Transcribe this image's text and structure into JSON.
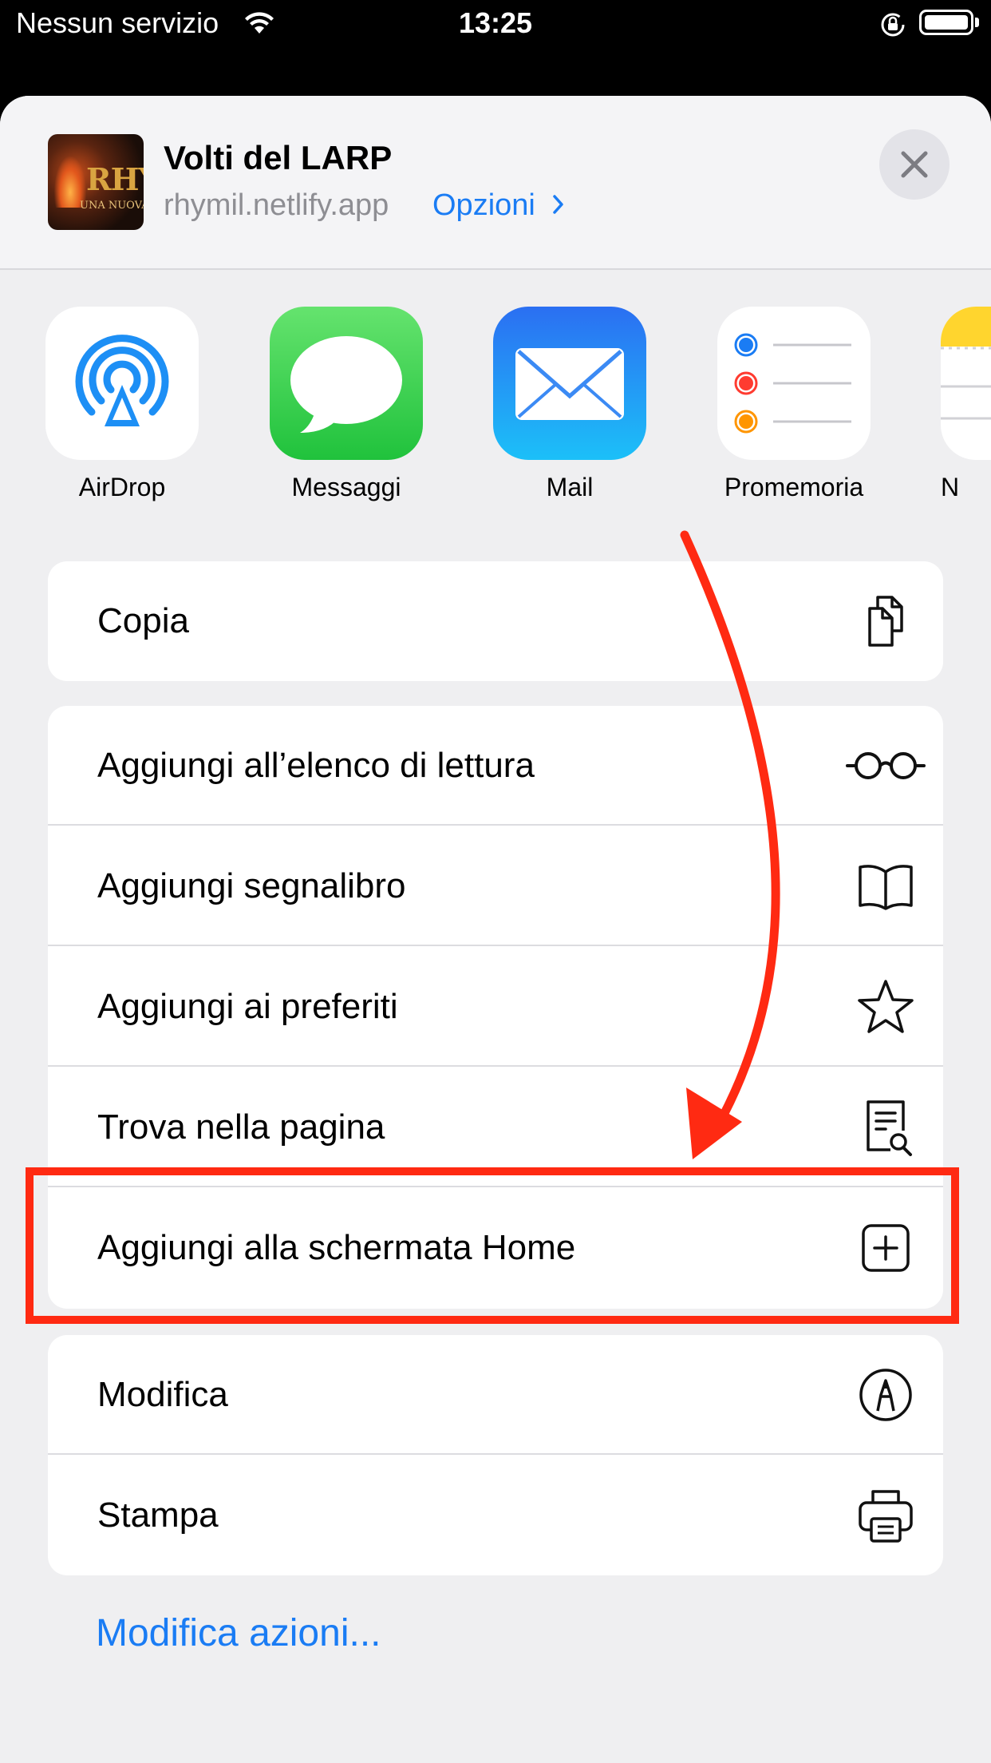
{
  "status_bar": {
    "carrier": "Nessun servizio",
    "time": "13:25"
  },
  "share_header": {
    "title": "Volti del LARP",
    "url": "rhymil.netlify.app",
    "options_label": "Opzioni",
    "thumbnail_text": "RHYMI",
    "thumbnail_subtext": "UNA NUOVA E"
  },
  "apps": [
    {
      "label": "AirDrop",
      "icon": "airdrop-icon"
    },
    {
      "label": "Messaggi",
      "icon": "messages-icon"
    },
    {
      "label": "Mail",
      "icon": "mail-icon"
    },
    {
      "label": "Promemoria",
      "icon": "reminders-icon"
    },
    {
      "label": "N",
      "icon": "notes-icon"
    }
  ],
  "actions": {
    "copy": {
      "label": "Copia",
      "icon": "copy-icon"
    },
    "reading_list": {
      "label": "Aggiungi all’elenco di lettura",
      "icon": "glasses-icon"
    },
    "bookmark": {
      "label": "Aggiungi segnalibro",
      "icon": "book-icon"
    },
    "favorites": {
      "label": "Aggiungi ai preferiti",
      "icon": "star-icon"
    },
    "find": {
      "label": "Trova nella pagina",
      "icon": "find-page-icon"
    },
    "home_screen": {
      "label": "Aggiungi alla schermata Home",
      "icon": "add-square-icon"
    },
    "markup": {
      "label": "Modifica",
      "icon": "markup-icon"
    },
    "print": {
      "label": "Stampa",
      "icon": "printer-icon"
    }
  },
  "edit_actions_label": "Modifica azioni...",
  "colors": {
    "accent": "#1a7cf4",
    "annotation": "#ff2a12"
  }
}
